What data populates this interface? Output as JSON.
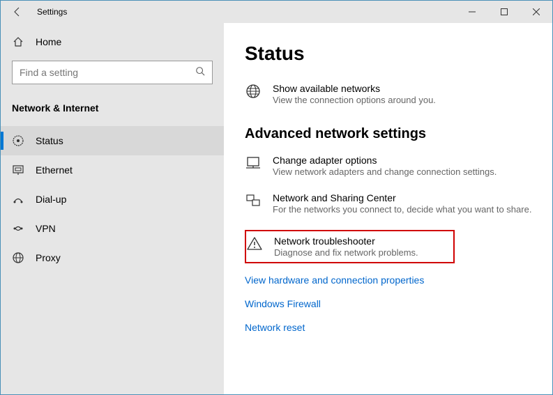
{
  "titlebar": {
    "title": "Settings"
  },
  "sidebar": {
    "home": "Home",
    "search_placeholder": "Find a setting",
    "section": "Network & Internet",
    "items": [
      {
        "label": "Status",
        "icon": "status"
      },
      {
        "label": "Ethernet",
        "icon": "ethernet"
      },
      {
        "label": "Dial-up",
        "icon": "dialup"
      },
      {
        "label": "VPN",
        "icon": "vpn"
      },
      {
        "label": "Proxy",
        "icon": "proxy"
      }
    ]
  },
  "main": {
    "heading": "Status",
    "show_networks": {
      "title": "Show available networks",
      "desc": "View the connection options around you."
    },
    "advanced_heading": "Advanced network settings",
    "adapter": {
      "title": "Change adapter options",
      "desc": "View network adapters and change connection settings."
    },
    "sharing": {
      "title": "Network and Sharing Center",
      "desc": "For the networks you connect to, decide what you want to share."
    },
    "troubleshooter": {
      "title": "Network troubleshooter",
      "desc": "Diagnose and fix network problems."
    },
    "links": {
      "hw": "View hardware and connection properties",
      "firewall": "Windows Firewall",
      "reset": "Network reset"
    }
  }
}
